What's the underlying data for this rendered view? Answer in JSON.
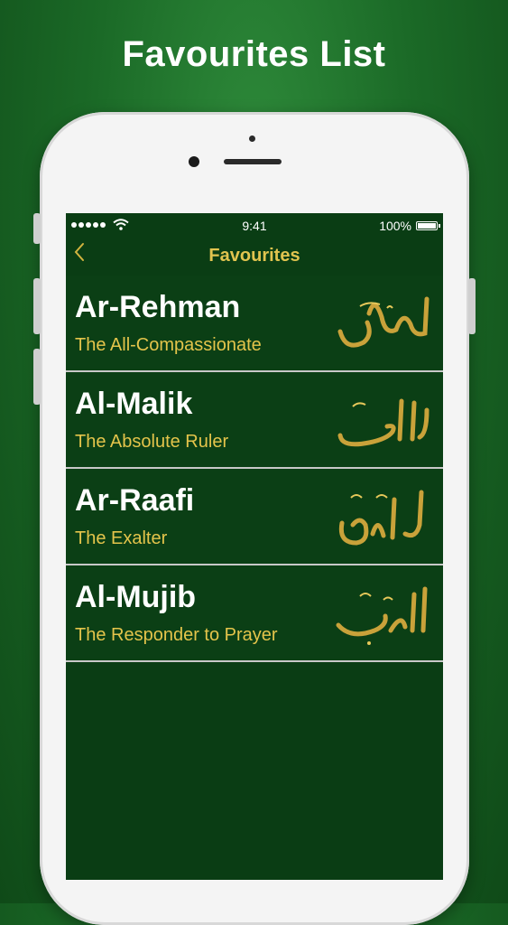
{
  "promo": {
    "title": "Favourites List"
  },
  "status_bar": {
    "time": "9:41",
    "battery": "100%"
  },
  "nav": {
    "back_icon": "chevron-left-icon",
    "title": "Favourites"
  },
  "names": [
    {
      "name": "Ar-Rehman",
      "meaning": "The All-Compassionate",
      "arabic": "الرحمن"
    },
    {
      "name": "Al-Malik",
      "meaning": "The Absolute Ruler",
      "arabic": "الملك"
    },
    {
      "name": "Ar-Raafi",
      "meaning": "The Exalter",
      "arabic": "الرافع"
    },
    {
      "name": "Al-Mujib",
      "meaning": "The Responder to Prayer",
      "arabic": "المجيب"
    }
  ],
  "colors": {
    "gold": "#e1c44f",
    "screen_bg": "#0b3f15",
    "page_bg": "#1b6a27"
  }
}
